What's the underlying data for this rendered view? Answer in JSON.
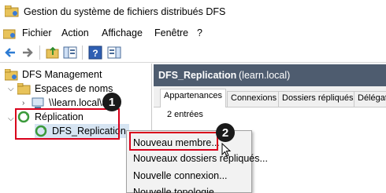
{
  "window": {
    "title": "Gestion du système de fichiers distribués DFS"
  },
  "menu": {
    "items": [
      "Fichier",
      "Action",
      "Affichage",
      "Fenêtre",
      "?"
    ]
  },
  "toolbar": {
    "buttons": [
      "back-icon",
      "forward-icon",
      "folder-up-icon",
      "console-tree-icon",
      "help-icon",
      "action-pane-icon"
    ]
  },
  "tree": {
    "root": "DFS Management",
    "namespaces": "Espaces de noms",
    "namespace_item": "\\\\learn.local\\a",
    "replication": "Réplication",
    "replication_group": "DFS_Replication"
  },
  "pane": {
    "title": "DFS_Replication",
    "subtitle": "(learn.local)",
    "tabs": [
      "Appartenances",
      "Connexions",
      "Dossiers répliqués",
      "Délégat"
    ],
    "active_tab": "Appartenances",
    "count": "2 entrées"
  },
  "context_menu": {
    "items": [
      "Nouveau membre...",
      "Nouveaux dossiers répliqués...",
      "Nouvelle connexion...",
      "Nouvelle topologie..."
    ]
  },
  "annotations": {
    "step1": "1",
    "step2": "2"
  },
  "colors": {
    "header_bg": "#4e5c6f",
    "highlight_red": "#d9001b",
    "badge_bg": "#1a1a1a"
  }
}
